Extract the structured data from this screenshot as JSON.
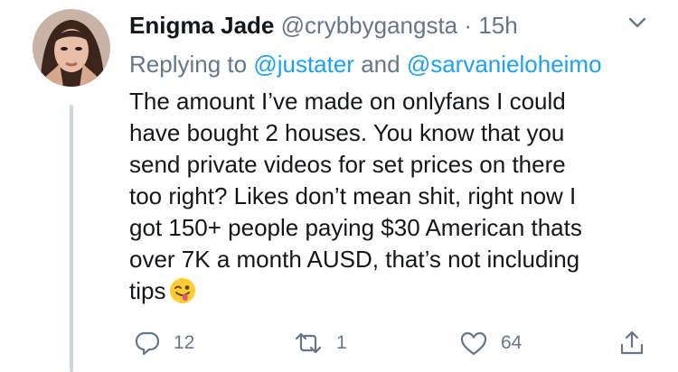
{
  "tweet": {
    "display_name": "Enigma Jade",
    "handle": "@crybbygangsta",
    "separator": "·",
    "time": "15h",
    "replying_prefix": "Replying to",
    "reply_mentions": [
      "@justater",
      "@sarvanieloheimo"
    ],
    "reply_joiner": "and",
    "lines": [
      "The amount I’ve made on onlyfans I could",
      "have bought 2 houses. You know that you",
      "send private videos for set prices on there",
      "too right? Likes don’t mean shit, right now I",
      "got 150+ people paying $30 American thats",
      "over 7K a month AUSD, that’s not including",
      "tips"
    ],
    "emoji": "winking-face-with-tongue"
  },
  "actions": {
    "reply_count": "12",
    "retweet_count": "1",
    "like_count": "64"
  },
  "colors": {
    "text": "#14171a",
    "secondary": "#657786",
    "link": "#1da1f2",
    "thread_line": "#ccd6dd"
  }
}
